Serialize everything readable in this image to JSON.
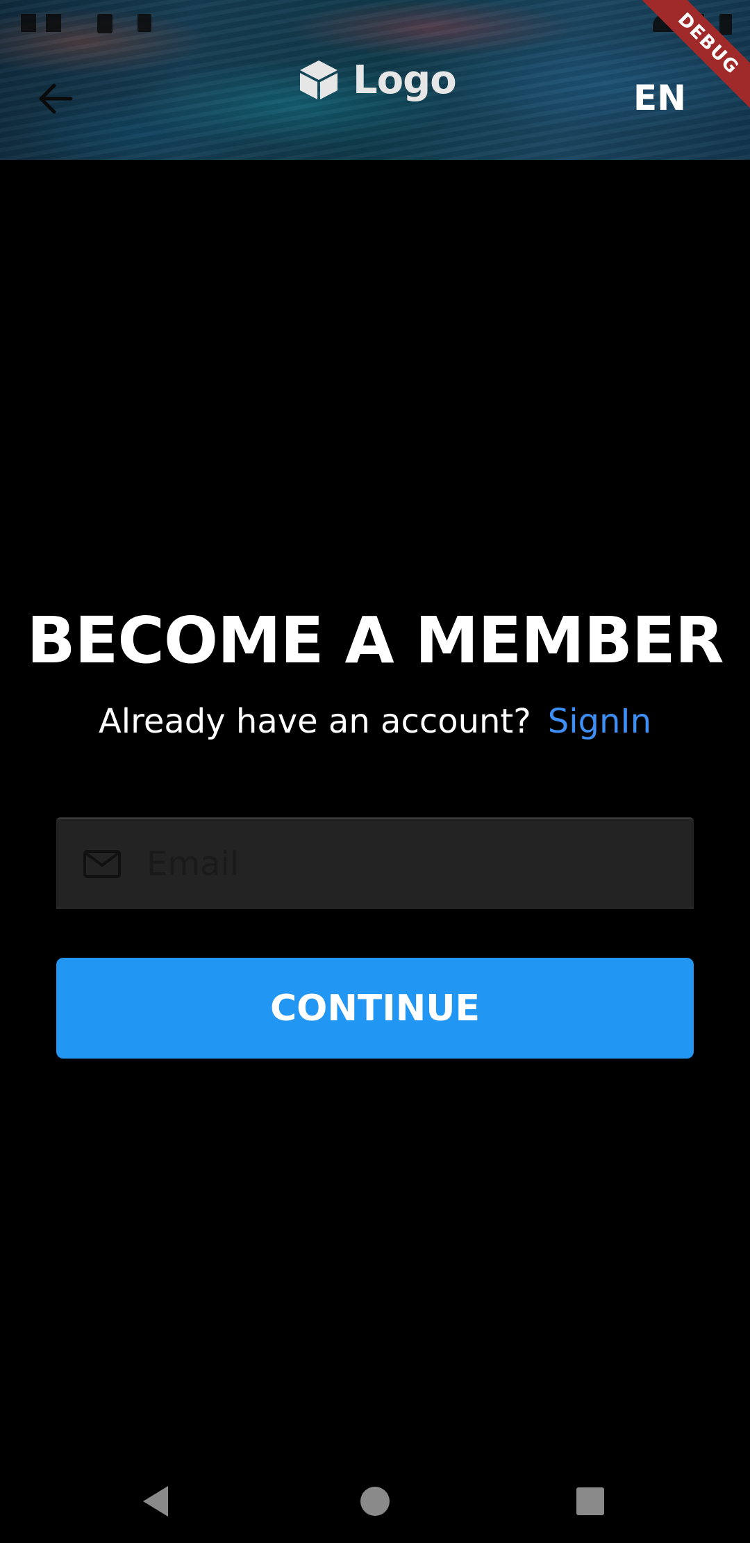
{
  "header": {
    "logo_text": "Logo",
    "language": "EN",
    "debug_banner": "DEBUG"
  },
  "main": {
    "title": "BECOME A MEMBER",
    "account_prompt": "Already have an account?",
    "signin_link": "SignIn",
    "email_placeholder": "Email",
    "email_value": "",
    "continue_label": "CONTINUE"
  },
  "icons": {
    "back": "arrow-left-icon",
    "logo": "cube-icon",
    "email": "mail-icon",
    "nav_back": "triangle-back-icon",
    "nav_home": "circle-home-icon",
    "nav_recents": "square-recents-icon"
  },
  "colors": {
    "background": "#000000",
    "accent": "#2196f3",
    "link": "#3d8ff5",
    "field_background": "#232323",
    "debug_ribbon": "#a02a2a"
  }
}
